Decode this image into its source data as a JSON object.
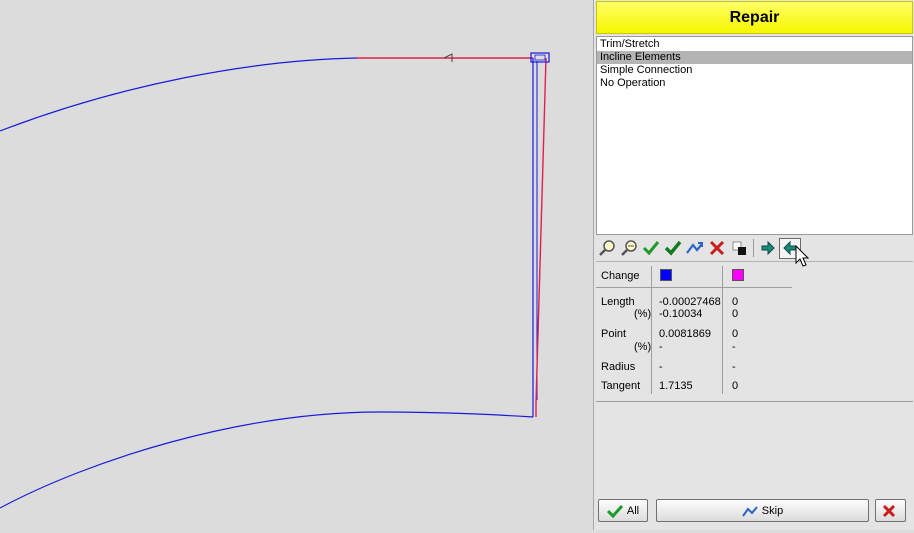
{
  "panel": {
    "title": "Repair",
    "operations": [
      {
        "label": "Trim/Stretch",
        "selected": false
      },
      {
        "label": "Incline Elements",
        "selected": true
      },
      {
        "label": "Simple Connection",
        "selected": false
      },
      {
        "label": "No Operation",
        "selected": false
      }
    ],
    "toolbar": [
      {
        "icon": "zoom-in-icon"
      },
      {
        "icon": "zoom-out-icon"
      },
      {
        "icon": "check-icon"
      },
      {
        "icon": "check-all-icon"
      },
      {
        "icon": "curve-arrow-icon"
      },
      {
        "icon": "delete-icon"
      },
      {
        "icon": "swap-color-icon"
      },
      {
        "icon": "next-arrow-icon"
      },
      {
        "icon": "previous-arrow-icon"
      }
    ],
    "info": {
      "change_label": "Change",
      "element1_color": "#0000ff",
      "element2_color": "#ff00ff",
      "length_label": "Length",
      "length_pct_label": "(%)",
      "length_val1": "-0.00027468",
      "length_pct_val1": "-0.10034",
      "length_val2": "0",
      "length_pct_val2": "0",
      "point_label": "Point",
      "point_pct_label": "(%)",
      "point_val1": "0.0081869",
      "point_pct_val1": "-",
      "point_val2": "0",
      "point_pct_val2": "-",
      "radius_label": "Radius",
      "radius_val1": "-",
      "radius_val2": "-",
      "tangent_label": "Tangent",
      "tangent_val1": "1.7135",
      "tangent_val2": "0"
    },
    "buttons": {
      "all_label": "All",
      "skip_label": "Skip"
    }
  }
}
